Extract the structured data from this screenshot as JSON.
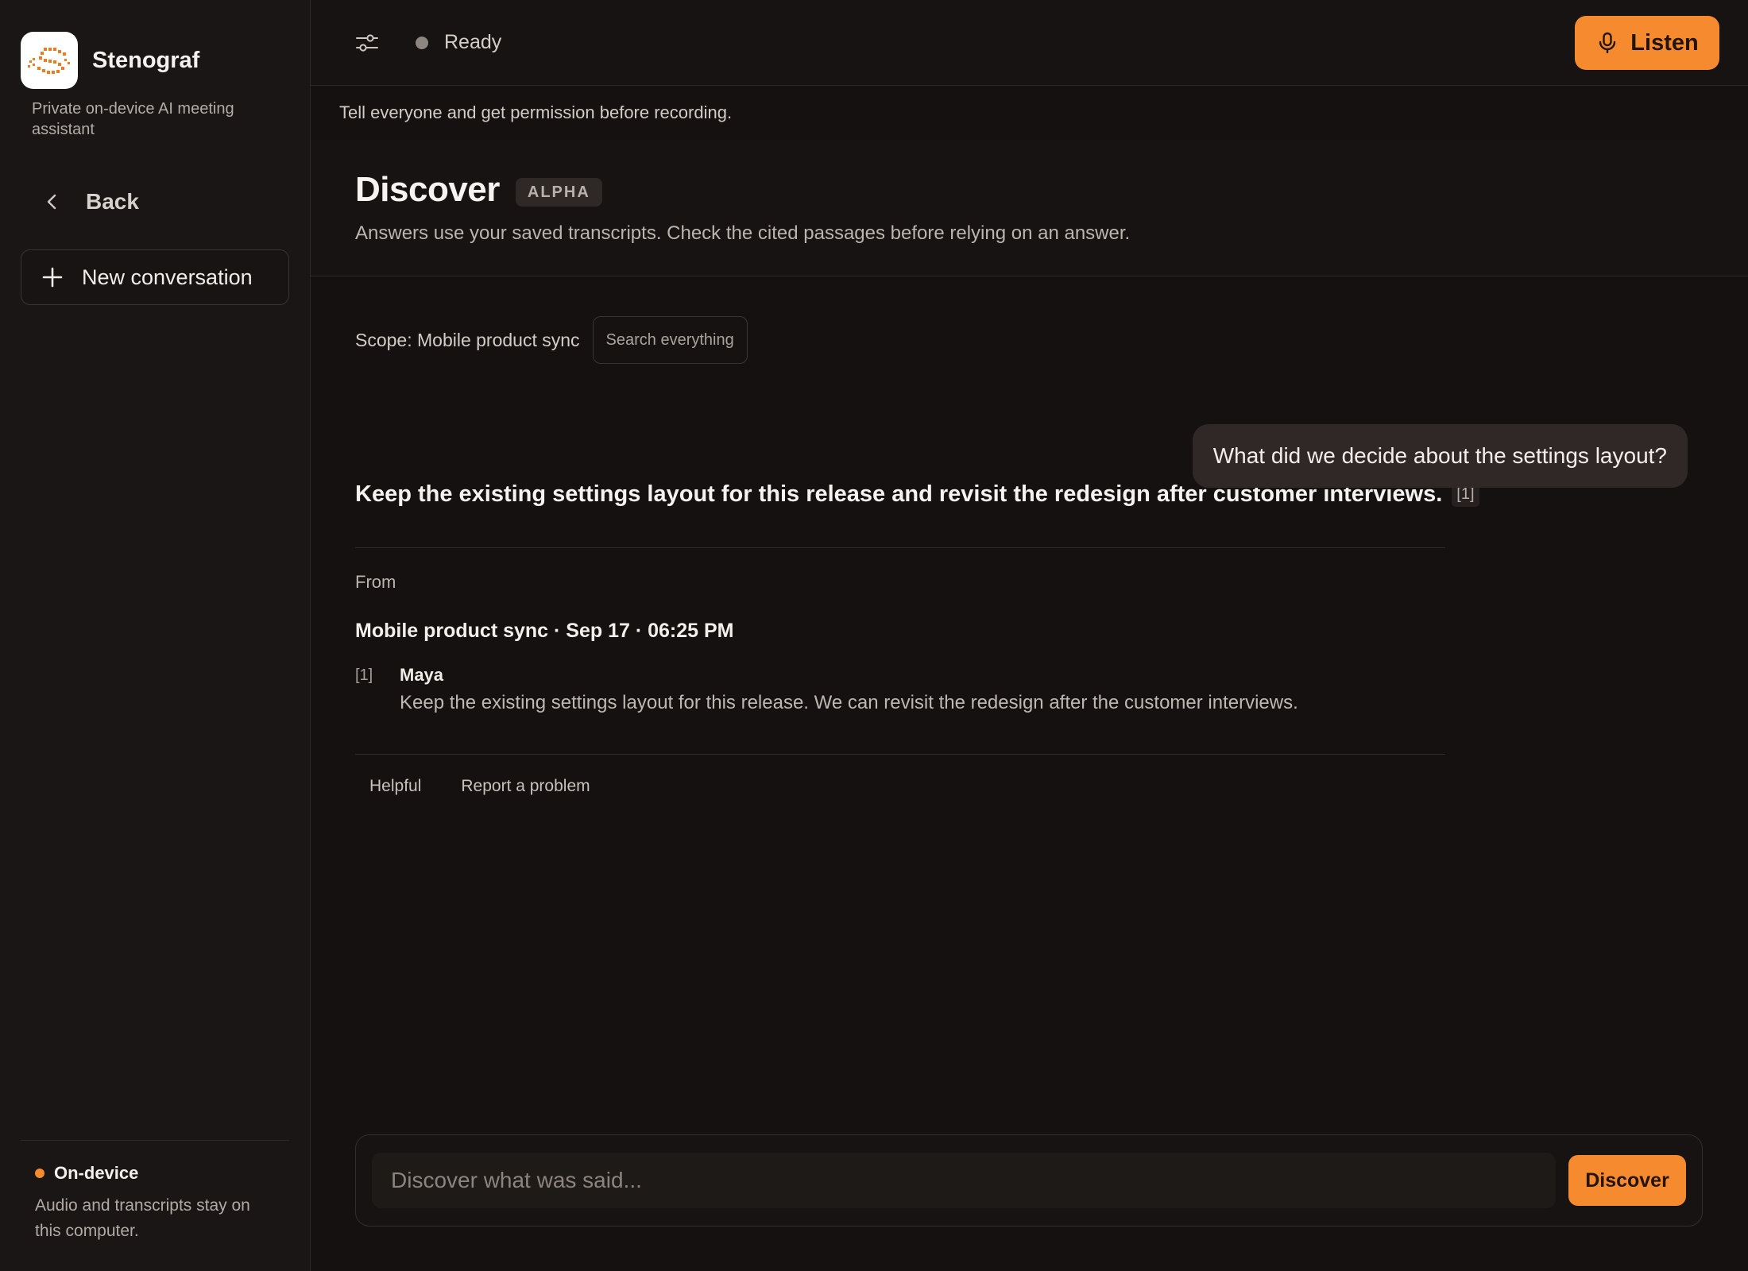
{
  "app": {
    "name": "Stenograf",
    "tagline": "Private on-device AI meeting assistant"
  },
  "sidebar": {
    "back_label": "Back",
    "new_conversation_label": "New conversation",
    "footer": {
      "title": "On-device",
      "text": "Audio and transcripts stay on this computer."
    }
  },
  "topbar": {
    "status": "Ready",
    "listen_label": "Listen"
  },
  "notice": "Tell everyone and get permission before recording.",
  "header": {
    "title": "Discover",
    "badge": "ALPHA",
    "subtitle": "Answers use your saved transcripts. Check the cited passages before relying on an answer."
  },
  "scope": {
    "label": "Scope: Mobile product sync",
    "button": "Search everything"
  },
  "conversation": {
    "question": "What did we decide about the settings layout?",
    "answer": "Keep the existing settings layout for this release and revisit the redesign after customer interviews.",
    "answer_citation": "[1]",
    "sources": {
      "from_label": "From",
      "meeting": "Mobile product sync · Sep 17 · 06:25 PM",
      "quotes": [
        {
          "ref": "[1]",
          "speaker": "Maya",
          "text": "Keep the existing settings layout for this release. We can revisit the redesign after the customer interviews."
        }
      ]
    },
    "feedback": {
      "helpful": "Helpful",
      "report": "Report a problem"
    }
  },
  "composer": {
    "placeholder": "Discover what was said...",
    "submit_label": "Discover"
  },
  "colors": {
    "accent": "#f58a2e",
    "background": "#141110",
    "sidebar": "#1a1615"
  },
  "icons": {
    "logo": "stenograf-logo",
    "back": "chevron-left-icon",
    "new": "plus-icon",
    "settings": "sliders-icon",
    "status": "status-dot",
    "listen": "microphone-icon"
  }
}
